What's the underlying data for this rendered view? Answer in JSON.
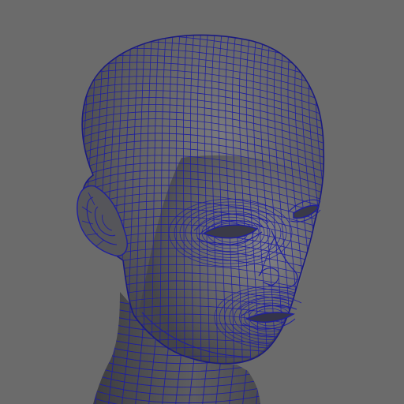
{
  "viewport": {
    "background": "#6b6b6b",
    "model": {
      "subject": "head-mesh",
      "surface_color": "#5c5c5e",
      "wireframe_color": "#1f1f9e",
      "display_mode": "smooth-shade-wireframe-on-shaded"
    }
  }
}
